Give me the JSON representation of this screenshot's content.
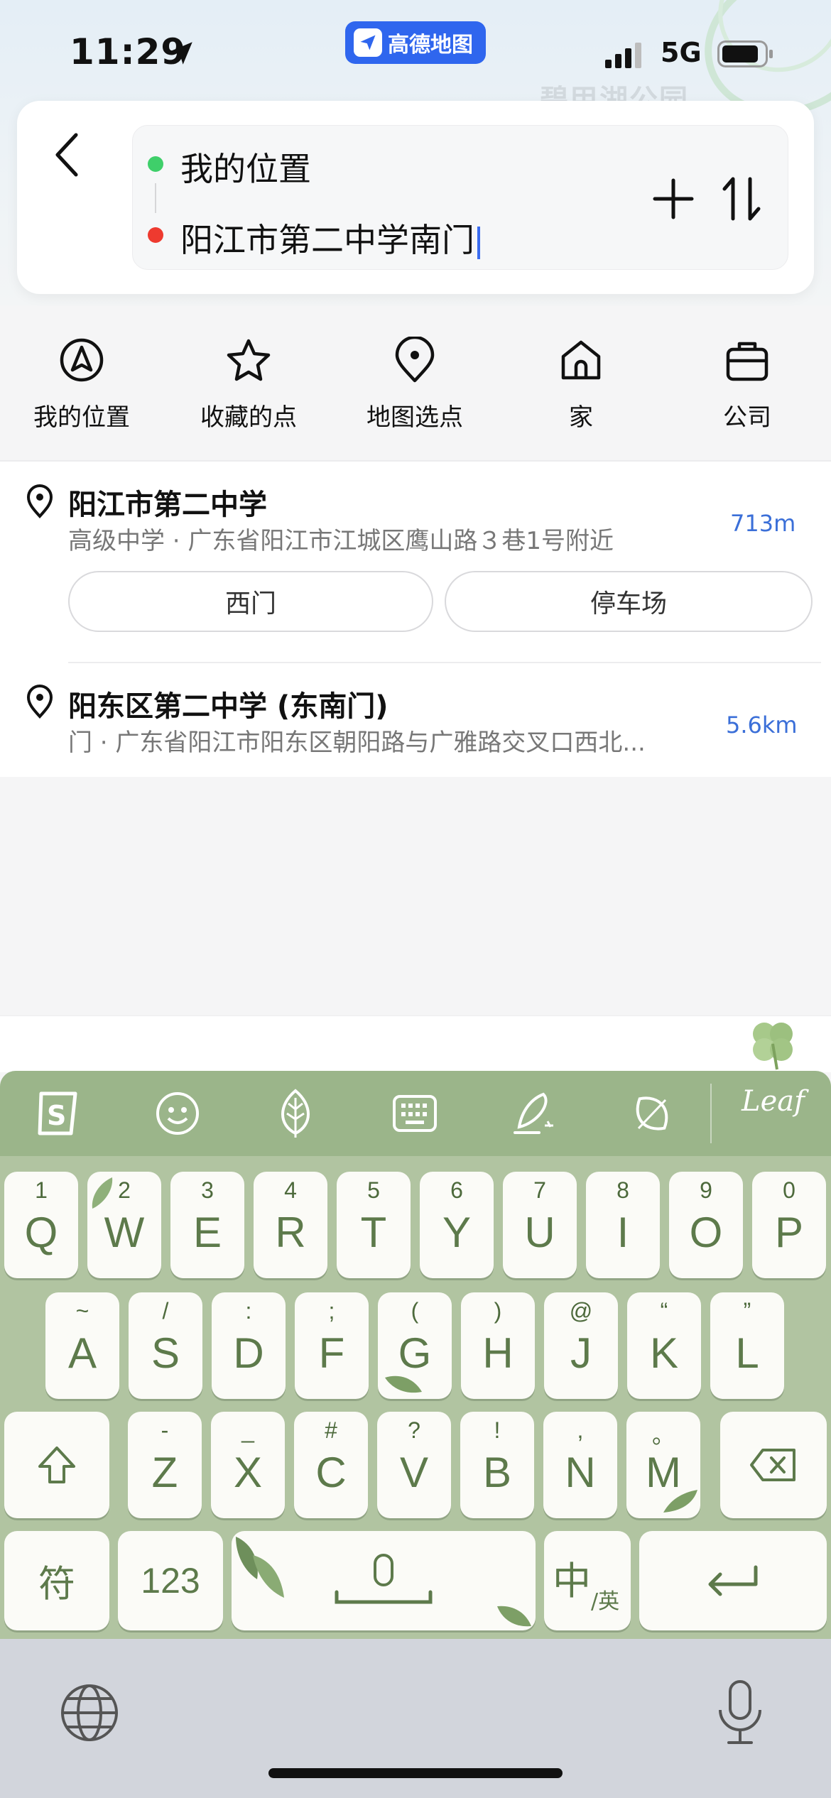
{
  "status_bar": {
    "time": "11:29",
    "app_badge": "高德地图",
    "network": "5G"
  },
  "map": {
    "faded_label": "碧甲湖公园"
  },
  "route": {
    "origin": "我的位置",
    "destination": "阳江市第二中学南门"
  },
  "shortcuts": [
    {
      "label": "我的位置",
      "icon": "navigation-arrow-icon"
    },
    {
      "label": "收藏的点",
      "icon": "star-icon"
    },
    {
      "label": "地图选点",
      "icon": "map-pin-target-icon"
    },
    {
      "label": "家",
      "icon": "home-icon"
    },
    {
      "label": "公司",
      "icon": "briefcase-icon"
    }
  ],
  "results": [
    {
      "title": "阳江市第二中学",
      "subtitle": "高级中学 · 广东省阳江市江城区鹰山路３巷1号附近",
      "distance": "713m",
      "sub_entries": [
        "西门",
        "停车场"
      ]
    },
    {
      "title": "阳东区第二中学 (东南门)",
      "subtitle": "门 · 广东省阳江市阳东区朝阳路与广雅路交叉口西北...",
      "distance": "5.6km"
    }
  ],
  "keyboard": {
    "toolbar_brand": "Leaf",
    "row1": [
      {
        "hint": "1",
        "key": "Q"
      },
      {
        "hint": "2",
        "key": "W"
      },
      {
        "hint": "3",
        "key": "E"
      },
      {
        "hint": "4",
        "key": "R"
      },
      {
        "hint": "5",
        "key": "T"
      },
      {
        "hint": "6",
        "key": "Y"
      },
      {
        "hint": "7",
        "key": "U"
      },
      {
        "hint": "8",
        "key": "I"
      },
      {
        "hint": "9",
        "key": "O"
      },
      {
        "hint": "0",
        "key": "P"
      }
    ],
    "row2": [
      {
        "hint": "~",
        "key": "A"
      },
      {
        "hint": "/",
        "key": "S"
      },
      {
        "hint": ":",
        "key": "D"
      },
      {
        "hint": ";",
        "key": "F"
      },
      {
        "hint": "(",
        "key": "G"
      },
      {
        "hint": ")",
        "key": "H"
      },
      {
        "hint": "@",
        "key": "J"
      },
      {
        "hint": "“",
        "key": "K"
      },
      {
        "hint": "”",
        "key": "L"
      }
    ],
    "row3": [
      {
        "hint": "-",
        "key": "Z"
      },
      {
        "hint": "_",
        "key": "X"
      },
      {
        "hint": "#",
        "key": "C"
      },
      {
        "hint": "?",
        "key": "V"
      },
      {
        "hint": "!",
        "key": "B"
      },
      {
        "hint": ",",
        "key": "N"
      },
      {
        "hint": "。",
        "key": "M"
      }
    ],
    "symbols_label": "符",
    "numbers_label": "123",
    "lang_main": "中",
    "lang_sub": "/英"
  },
  "colors": {
    "accent_blue": "#2f66ee",
    "distance_blue": "#3b6fd8",
    "origin_green": "#3fcf6a",
    "dest_red": "#ee3a2f",
    "keyboard_green": "#9bb58a",
    "key_text_green": "#5d7a4b"
  }
}
